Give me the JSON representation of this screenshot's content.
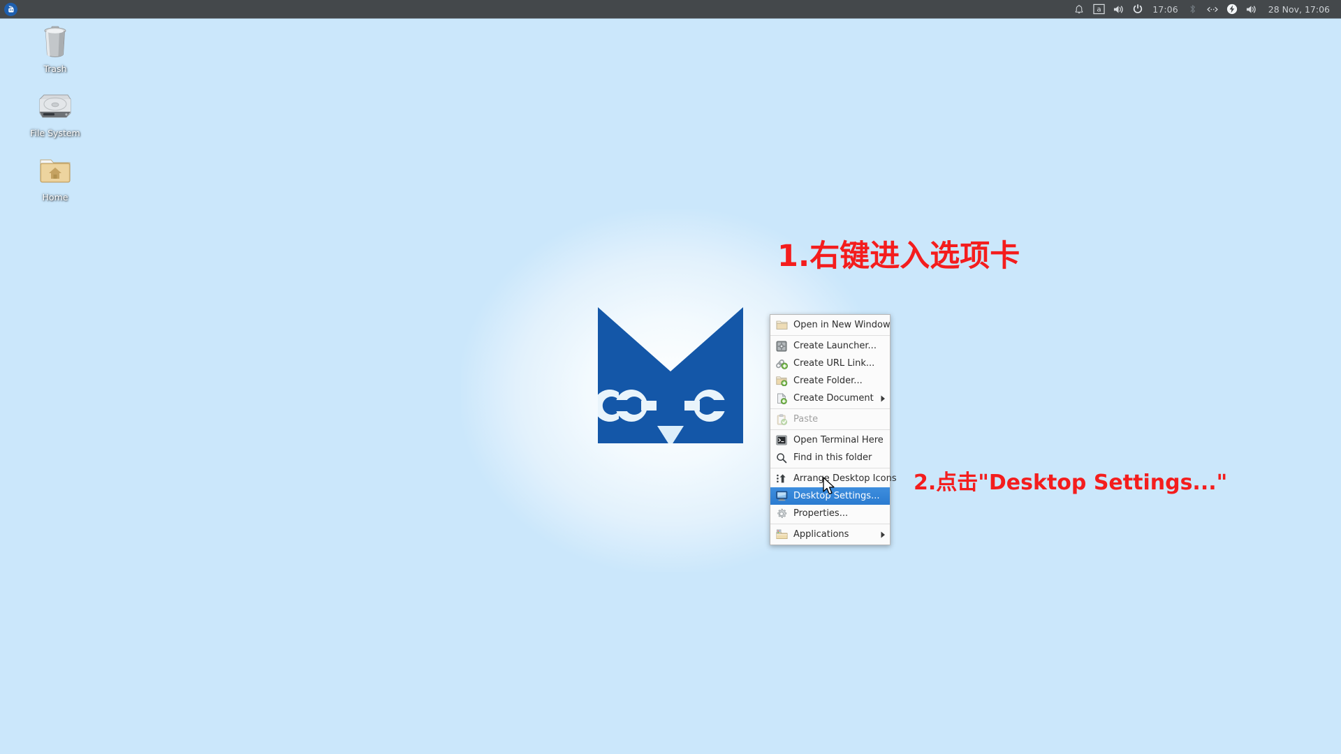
{
  "desktop": {
    "background_color": "#cbe7fb",
    "logo_color": "#1457a8",
    "logo_name": "xfce-mouse-logo"
  },
  "panel": {
    "background_color": "#44484b",
    "launcher_icon": "xfce-mouse-launcher-icon",
    "tray": [
      {
        "name": "notification-bell-icon",
        "glyph": "bell"
      },
      {
        "name": "keyboard-layout-indicator",
        "glyph": "a"
      },
      {
        "name": "volume-icon",
        "glyph": "speaker"
      },
      {
        "name": "power-menu-icon",
        "glyph": "power"
      }
    ],
    "clock": "17:06",
    "tray2": [
      {
        "name": "bluetooth-icon",
        "glyph": "bluetooth"
      },
      {
        "name": "network-icon",
        "glyph": "network"
      },
      {
        "name": "power-manager-icon",
        "glyph": "battery-bolt"
      },
      {
        "name": "audio-mixer-icon",
        "glyph": "speaker"
      }
    ],
    "datetime": "28 Nov, 17:06"
  },
  "desktop_icons": [
    {
      "label": "Trash",
      "icon": "trash-icon"
    },
    {
      "label": "File System",
      "icon": "harddisk-icon"
    },
    {
      "label": "Home",
      "icon": "home-folder-icon"
    }
  ],
  "context_menu": {
    "items": [
      {
        "label": "Open in New Window",
        "icon": "folder-icon",
        "state": "normal",
        "submenu": false
      },
      {
        "type": "separator"
      },
      {
        "label": "Create Launcher...",
        "icon": "launcher-icon",
        "state": "normal",
        "submenu": false
      },
      {
        "label": "Create URL Link...",
        "icon": "url-link-icon",
        "state": "normal",
        "submenu": false
      },
      {
        "label": "Create Folder...",
        "icon": "new-folder-icon",
        "state": "normal",
        "submenu": false
      },
      {
        "label": "Create Document",
        "icon": "new-document-icon",
        "state": "normal",
        "submenu": true
      },
      {
        "type": "separator"
      },
      {
        "label": "Paste",
        "icon": "paste-icon",
        "state": "disabled",
        "submenu": false
      },
      {
        "type": "separator"
      },
      {
        "label": "Open Terminal Here",
        "icon": "terminal-icon",
        "state": "normal",
        "submenu": false
      },
      {
        "label": "Find in this folder",
        "icon": "search-icon",
        "state": "normal",
        "submenu": false
      },
      {
        "type": "separator"
      },
      {
        "label": "Arrange Desktop Icons",
        "icon": "arrange-icon",
        "state": "normal",
        "submenu": false
      },
      {
        "label": "Desktop Settings...",
        "icon": "desktop-settings-icon",
        "state": "selected",
        "submenu": false
      },
      {
        "label": "Properties...",
        "icon": "properties-gear-icon",
        "state": "normal",
        "submenu": false
      },
      {
        "type": "separator"
      },
      {
        "label": "Applications",
        "icon": "applications-icon",
        "state": "normal",
        "submenu": true
      }
    ],
    "highlight_color": "#2d7fd3"
  },
  "annotations": {
    "color": "#f41d1d",
    "step1": "1.右键进入选项卡",
    "step2": "2.点击\"Desktop Settings...\""
  }
}
